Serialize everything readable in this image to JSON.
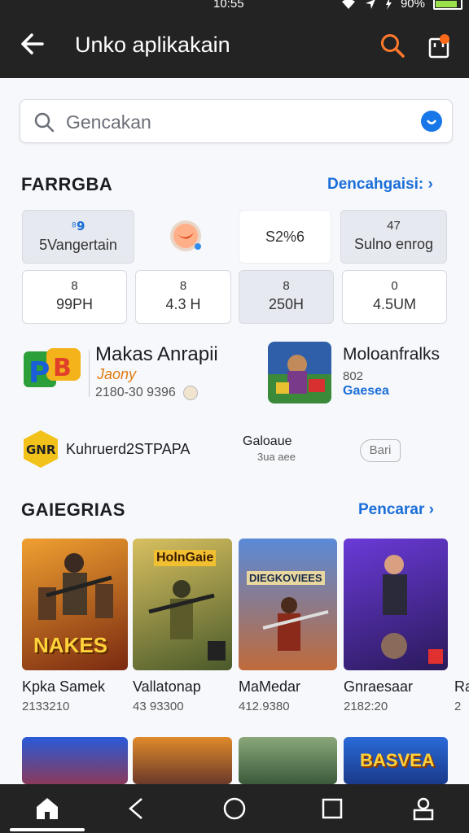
{
  "status": {
    "time": "10:55",
    "battery": "90%"
  },
  "appbar": {
    "title": "Unko aplikakain"
  },
  "search": {
    "placeholder": "Gencakan"
  },
  "section1": {
    "title": "FARRGBA",
    "link": "Dencahgaisi:",
    "pills": [
      {
        "top": "⁸𝟵",
        "bottom": "5Vangertain"
      },
      {
        "top": "",
        "bottom": ""
      },
      {
        "top": "",
        "bottom": "S2%6"
      },
      {
        "top": "47",
        "bottom": "Sulno enrog"
      },
      {
        "top": "8",
        "bottom": "99PH"
      },
      {
        "top": "8",
        "bottom": "4.3 H"
      },
      {
        "top": "8",
        "bottom": "250H"
      },
      {
        "top": "0",
        "bottom": "4.5UM"
      }
    ],
    "apps": [
      {
        "name": "Makas Anrapii",
        "sub": "Jaony",
        "meta": "2180-30 9396"
      },
      {
        "name": "Moloanfralks",
        "sub": "802",
        "genre": "Gaesea"
      },
      {
        "name": "Kuhruerd2STPAPA"
      },
      {
        "name": "Galoaue",
        "sub": "3ua aee"
      }
    ],
    "bari": "Bari"
  },
  "section2": {
    "title": "GAIEGRIAS",
    "link": "Pencarar",
    "games": [
      {
        "name": "Kpka Samek",
        "num": "2133210",
        "banner": "NAKES"
      },
      {
        "name": "Vallatonap",
        "num": "43 93300",
        "banner": "HolnGaie"
      },
      {
        "name": "MaMedar",
        "num": "412.9380",
        "banner": "DIEGKOVIEES"
      },
      {
        "name": "Gnraesaar",
        "num": "2182:20",
        "banner": ""
      },
      {
        "name": "Ra",
        "num": "2"
      }
    ],
    "row2_banner": "BASVEA"
  },
  "colors": {
    "dark": "#232323",
    "accent": "#1a6ed8",
    "orange": "#ff6a1a"
  }
}
